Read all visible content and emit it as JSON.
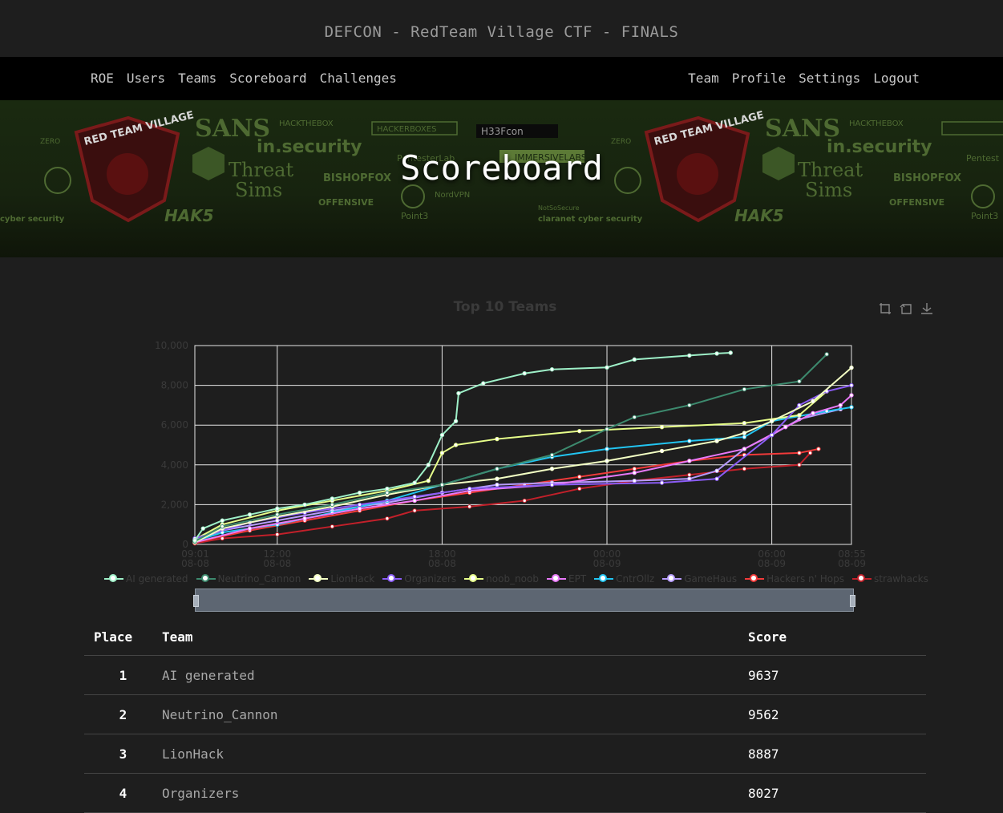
{
  "site": {
    "title": "DEFCON - RedTeam Village CTF - FINALS"
  },
  "nav": {
    "left": [
      "ROE",
      "Users",
      "Teams",
      "Scoreboard",
      "Challenges"
    ],
    "right": [
      "Team",
      "Profile",
      "Settings",
      "Logout"
    ]
  },
  "banner": {
    "heading": "Scoreboard",
    "sponsors": [
      "RED TEAM VILLAGE",
      "SANS",
      "HACKTHEBOX",
      "HACKERBOXES",
      "in.security",
      "PentesterLab",
      "IMMERSIVELABS",
      "Threat Sims",
      "BISHOPFOX",
      "OFFENSIVE security",
      "NordVPN",
      "Point3",
      "HAK5",
      "NotSoSecure",
      "clarainet cyber security",
      "ZERO POINT SECURITY",
      "no starch press",
      "H33Fcon"
    ]
  },
  "colors": {
    "background": "#1e1e1e",
    "navbar": "#000000",
    "series": [
      "#9ef0c8",
      "#3d8a6e",
      "#f3ffc4",
      "#8b5cf6",
      "#e7ff8a",
      "#e879f9",
      "#22c5f2",
      "#b79cff",
      "#f23a3a",
      "#c2202a"
    ]
  },
  "chart_data": {
    "type": "line",
    "title": "Top 10 Teams",
    "y_ticks": [
      "0",
      "2,000",
      "4,000",
      "6,000",
      "8,000",
      "10,000"
    ],
    "x_ticks": [
      {
        "time": "09:01",
        "date": "08-08"
      },
      {
        "time": "12:00",
        "date": "08-08"
      },
      {
        "time": "18:00",
        "date": "08-08"
      },
      {
        "time": "00:00",
        "date": "08-09"
      },
      {
        "time": "06:00",
        "date": "08-09"
      },
      {
        "time": "08:55",
        "date": "08-09"
      }
    ],
    "ylim": [
      0,
      10000
    ],
    "xlim_hours": [
      9.0,
      32.9
    ],
    "grid": true,
    "legend_position": "bottom",
    "series": [
      {
        "name": "AI generated",
        "points": [
          [
            9.0,
            200
          ],
          [
            9.3,
            800
          ],
          [
            10,
            1200
          ],
          [
            11,
            1500
          ],
          [
            12,
            1800
          ],
          [
            13,
            2000
          ],
          [
            14,
            2300
          ],
          [
            15,
            2600
          ],
          [
            16,
            2800
          ],
          [
            17,
            3100
          ],
          [
            17.5,
            4000
          ],
          [
            18,
            5500
          ],
          [
            18.5,
            6200
          ],
          [
            18.6,
            7600
          ],
          [
            19.5,
            8100
          ],
          [
            21,
            8600
          ],
          [
            22,
            8800
          ],
          [
            24,
            8900
          ],
          [
            25,
            9300
          ],
          [
            27,
            9500
          ],
          [
            28,
            9600
          ],
          [
            28.5,
            9637
          ]
        ]
      },
      {
        "name": "Neutrino_Cannon",
        "points": [
          [
            9.0,
            150
          ],
          [
            10,
            900
          ],
          [
            12,
            1500
          ],
          [
            14,
            2000
          ],
          [
            16,
            2600
          ],
          [
            18,
            3000
          ],
          [
            20,
            3800
          ],
          [
            22,
            4500
          ],
          [
            24,
            5800
          ],
          [
            25,
            6400
          ],
          [
            27,
            7000
          ],
          [
            29,
            7800
          ],
          [
            31,
            8200
          ],
          [
            32,
            9562
          ]
        ]
      },
      {
        "name": "LionHack",
        "points": [
          [
            9.0,
            100
          ],
          [
            10,
            800
          ],
          [
            12,
            1400
          ],
          [
            14,
            1900
          ],
          [
            16,
            2500
          ],
          [
            18,
            3000
          ],
          [
            20,
            3300
          ],
          [
            22,
            3800
          ],
          [
            24,
            4200
          ],
          [
            26,
            4700
          ],
          [
            28,
            5200
          ],
          [
            29,
            5600
          ],
          [
            30,
            6200
          ],
          [
            31.5,
            7200
          ],
          [
            32.9,
            8887
          ]
        ]
      },
      {
        "name": "Organizers",
        "points": [
          [
            9.0,
            300
          ],
          [
            11,
            1100
          ],
          [
            13,
            1600
          ],
          [
            15,
            2000
          ],
          [
            17,
            2400
          ],
          [
            19,
            2800
          ],
          [
            22,
            3000
          ],
          [
            26,
            3100
          ],
          [
            28,
            3300
          ],
          [
            30,
            5500
          ],
          [
            31,
            7000
          ],
          [
            32,
            7700
          ],
          [
            32.9,
            8000
          ]
        ]
      },
      {
        "name": "noob_noob",
        "points": [
          [
            9.0,
            250
          ],
          [
            10,
            1000
          ],
          [
            12,
            1700
          ],
          [
            14,
            2200
          ],
          [
            16,
            2700
          ],
          [
            17.5,
            3200
          ],
          [
            18,
            4600
          ],
          [
            18.5,
            5000
          ],
          [
            20,
            5300
          ],
          [
            23,
            5700
          ],
          [
            26,
            5900
          ],
          [
            29,
            6100
          ],
          [
            31,
            6500
          ],
          [
            32,
            7700
          ]
        ]
      },
      {
        "name": "EPT",
        "points": [
          [
            9.0,
            100
          ],
          [
            11,
            800
          ],
          [
            13,
            1300
          ],
          [
            15,
            1800
          ],
          [
            17,
            2200
          ],
          [
            19,
            2700
          ],
          [
            22,
            3000
          ],
          [
            25,
            3600
          ],
          [
            27,
            4200
          ],
          [
            29,
            4800
          ],
          [
            30.5,
            5900
          ],
          [
            31.5,
            6600
          ],
          [
            32.5,
            7000
          ],
          [
            32.9,
            7500
          ]
        ]
      },
      {
        "name": "CntrOllz",
        "points": [
          [
            9.0,
            150
          ],
          [
            10,
            600
          ],
          [
            12,
            1000
          ],
          [
            14,
            1600
          ],
          [
            16,
            2200
          ],
          [
            18,
            3000
          ],
          [
            20,
            3800
          ],
          [
            22,
            4400
          ],
          [
            24,
            4800
          ],
          [
            27,
            5200
          ],
          [
            29,
            5400
          ],
          [
            30,
            6200
          ],
          [
            32,
            6700
          ],
          [
            32.9,
            6900
          ]
        ]
      },
      {
        "name": "GameHaus",
        "points": [
          [
            9.0,
            200
          ],
          [
            10,
            700
          ],
          [
            12,
            1200
          ],
          [
            14,
            1700
          ],
          [
            16,
            2100
          ],
          [
            18,
            2600
          ],
          [
            20,
            3000
          ],
          [
            22,
            3100
          ],
          [
            25,
            3200
          ],
          [
            27,
            3300
          ],
          [
            28,
            3700
          ],
          [
            29,
            4800
          ],
          [
            30,
            5500
          ],
          [
            31,
            6300
          ],
          [
            32.5,
            6800
          ]
        ]
      },
      {
        "name": "Hackers n' Hops",
        "points": [
          [
            9.0,
            100
          ],
          [
            11,
            700
          ],
          [
            13,
            1200
          ],
          [
            15,
            1700
          ],
          [
            17,
            2200
          ],
          [
            19,
            2600
          ],
          [
            21,
            3000
          ],
          [
            23,
            3400
          ],
          [
            25,
            3800
          ],
          [
            27,
            4200
          ],
          [
            29,
            4500
          ],
          [
            31,
            4600
          ],
          [
            31.7,
            4800
          ]
        ]
      },
      {
        "name": "strawhacks",
        "points": [
          [
            9.0,
            50
          ],
          [
            10,
            300
          ],
          [
            12,
            500
          ],
          [
            14,
            900
          ],
          [
            16,
            1300
          ],
          [
            17,
            1700
          ],
          [
            19,
            1900
          ],
          [
            21,
            2200
          ],
          [
            23,
            2800
          ],
          [
            25,
            3200
          ],
          [
            27,
            3500
          ],
          [
            29,
            3800
          ],
          [
            31,
            4000
          ],
          [
            31.4,
            4600
          ]
        ]
      }
    ]
  },
  "table": {
    "headers": {
      "place": "Place",
      "team": "Team",
      "score": "Score"
    },
    "rows": [
      {
        "place": "1",
        "team": "AI generated",
        "score": "9637"
      },
      {
        "place": "2",
        "team": "Neutrino_Cannon",
        "score": "9562"
      },
      {
        "place": "3",
        "team": "LionHack",
        "score": "8887"
      },
      {
        "place": "4",
        "team": "Organizers",
        "score": "8027"
      }
    ]
  }
}
